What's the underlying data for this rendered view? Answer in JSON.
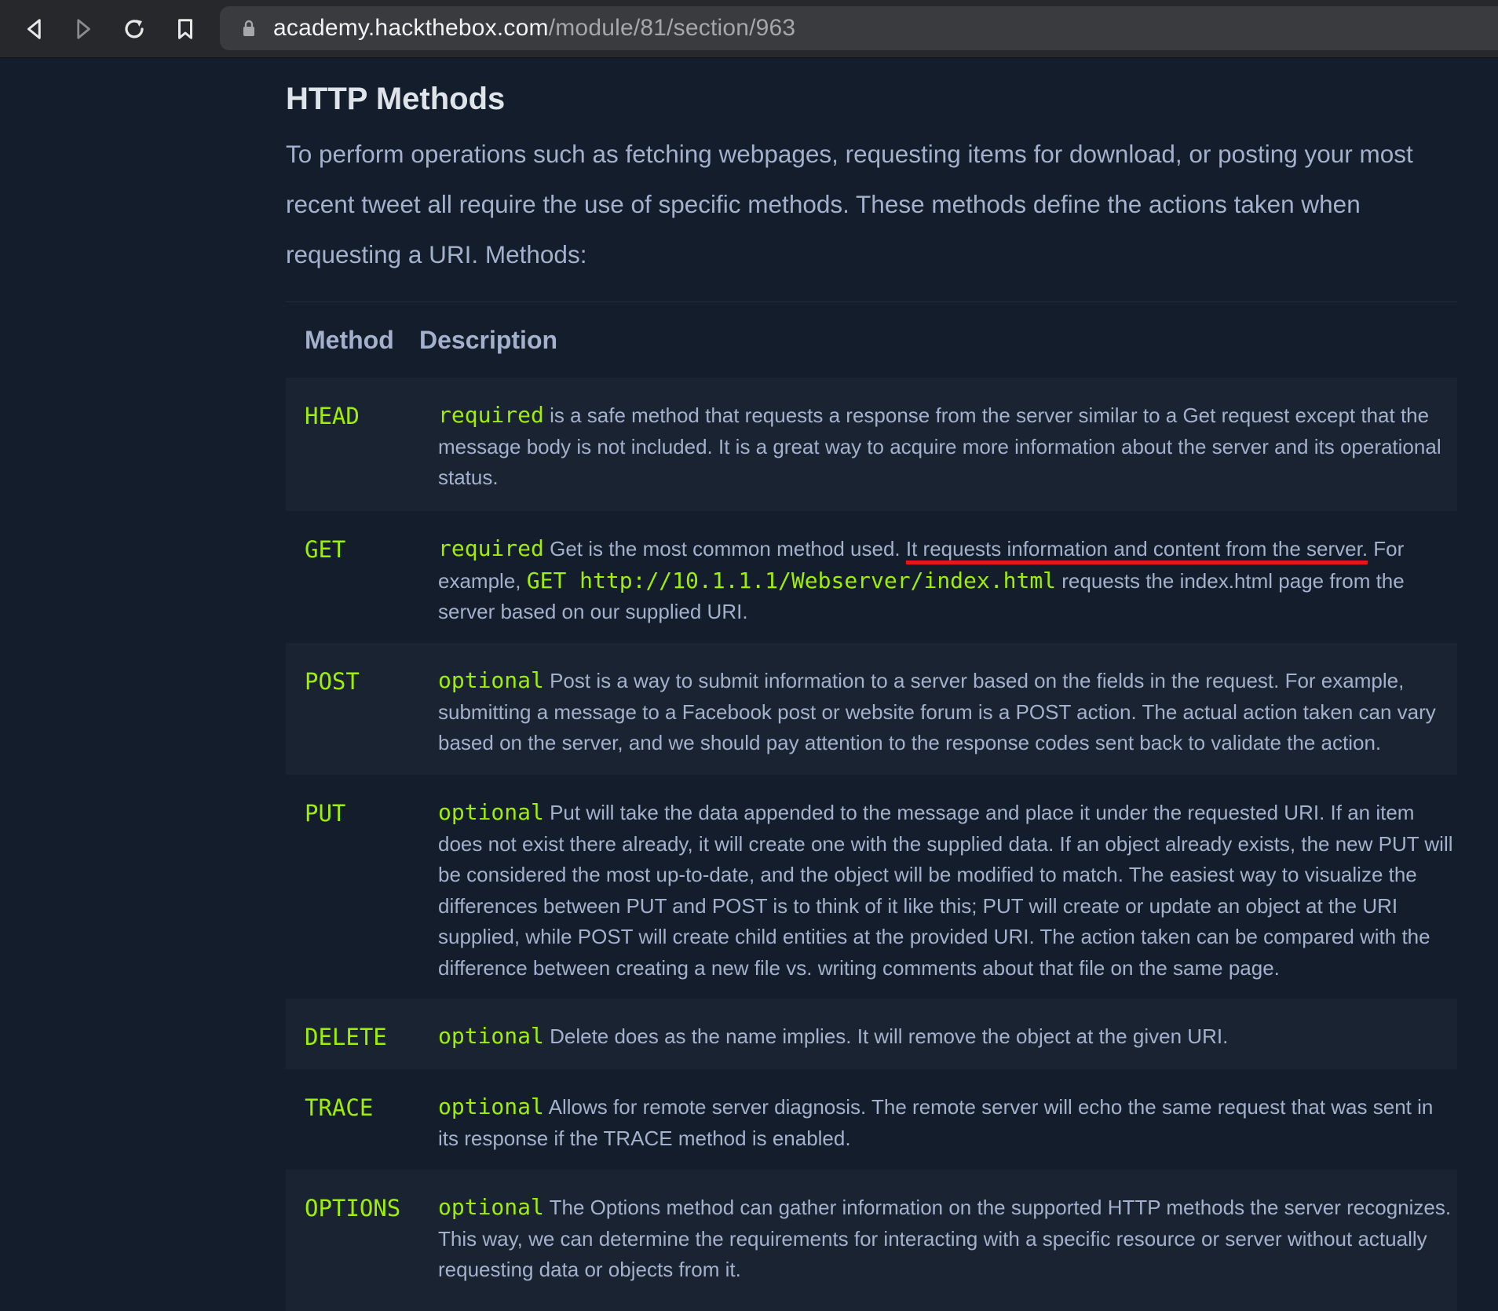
{
  "browser": {
    "url_host": "academy.hackthebox.com",
    "url_path": "/module/81/section/963",
    "icons": [
      "back-icon",
      "forward-icon",
      "reload-icon",
      "bookmark-icon",
      "lock-icon"
    ]
  },
  "page": {
    "title": "HTTP Methods",
    "intro": "To perform operations such as fetching webpages, requesting items for download, or posting your most recent tweet all require the use of specific methods. These methods define the actions taken when requesting a URI. Methods:"
  },
  "table": {
    "headers": {
      "method": "Method",
      "description": "Description"
    },
    "rows": [
      {
        "method": "HEAD",
        "tag": "required",
        "text": "is a safe method that requests a response from the server similar to a Get request except that the message body is not included. It is a great way to acquire more information about the server and its operational status."
      },
      {
        "method": "GET",
        "tag": "required",
        "text_a": "Get is the most common method used. ",
        "text_highlight": "It requests information and content from the server.",
        "text_b": " For example, ",
        "code": "GET http://10.1.1.1/Webserver/index.html",
        "text_c": " requests the index.html page from the server based on our supplied URI."
      },
      {
        "method": "POST",
        "tag": "optional",
        "text": "Post is a way to submit information to a server based on the fields in the request. For example, submitting a message to a Facebook post or website forum is a POST action. The actual action taken can vary based on the server, and we should pay attention to the response codes sent back to validate the action."
      },
      {
        "method": "PUT",
        "tag": "optional",
        "text": "Put will take the data appended to the message and place it under the requested URI. If an item does not exist there already, it will create one with the supplied data. If an object already exists, the new PUT will be considered the most up-to-date, and the object will be modified to match. The easiest way to visualize the differences between PUT and POST is to think of it like this; PUT will create or update an object at the URI supplied, while POST will create child entities at the provided URI. The action taken can be compared with the difference between creating a new file vs. writing comments about that file on the same page."
      },
      {
        "method": "DELETE",
        "tag": "optional",
        "text": "Delete does as the name implies. It will remove the object at the given URI."
      },
      {
        "method": "TRACE",
        "tag": "optional",
        "text": "Allows for remote server diagnosis. The remote server will echo the same request that was sent in its response if the TRACE method is enabled."
      },
      {
        "method": "OPTIONS",
        "tag": "optional",
        "text": "The Options method can gather information on the supported HTTP methods the server recognizes. This way, we can determine the requirements for interacting with a specific resource or server without actually requesting data or objects from it."
      }
    ]
  },
  "colors": {
    "background": "#141d2b",
    "row_shade": "#1a2332",
    "accent_green": "#9fef00",
    "body_text": "#a4b1cd",
    "underline_red": "#e8141e"
  }
}
